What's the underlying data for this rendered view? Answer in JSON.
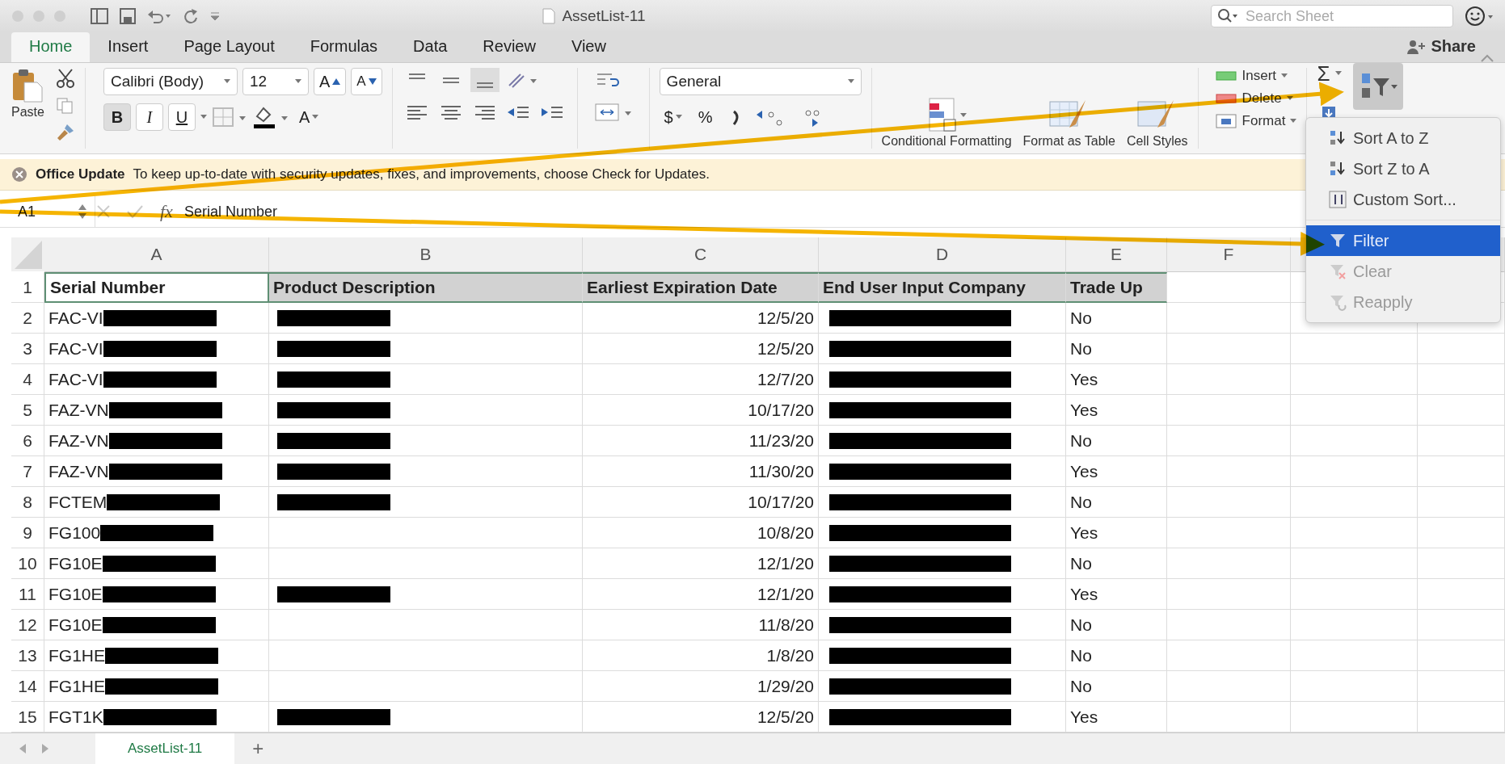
{
  "window": {
    "title": "AssetList-11",
    "search_placeholder": "Search Sheet"
  },
  "tabs": [
    {
      "label": "Home",
      "selected": true
    },
    {
      "label": "Insert",
      "selected": false
    },
    {
      "label": "Page Layout",
      "selected": false
    },
    {
      "label": "Formulas",
      "selected": false
    },
    {
      "label": "Data",
      "selected": false
    },
    {
      "label": "Review",
      "selected": false
    },
    {
      "label": "View",
      "selected": false
    }
  ],
  "share": "Share",
  "ribbon": {
    "paste": "Paste",
    "font_name": "Calibri (Body)",
    "font_size": "12",
    "bold": "B",
    "italic": "I",
    "underline": "U",
    "font_color": "A",
    "grow": "A",
    "shrink": "A",
    "number_format": "General",
    "currency": "$",
    "percent": "%",
    "conditional_formatting": "Conditional Formatting",
    "format_as_table": "Format as Table",
    "cell_styles": "Cell Styles",
    "insert": "Insert",
    "delete": "Delete",
    "format": "Format",
    "sum": "Σ"
  },
  "update_bar": {
    "title": "Office Update",
    "message": "To keep up-to-date with security updates, fixes, and improvements, choose Check for Updates."
  },
  "formula_bar": {
    "name_box": "A1",
    "fx": "fx",
    "value": "Serial Number"
  },
  "columns": [
    "A",
    "B",
    "C",
    "D",
    "E",
    "F"
  ],
  "header_row_num": "1",
  "header": [
    "Serial Number",
    "Product Description",
    "Earliest Expiration Date",
    "End User Input Company",
    "Trade Up"
  ],
  "rows": [
    {
      "num": "2",
      "serial": "FAC-VI",
      "product_redacted": true,
      "date": "12/5/20",
      "trade_up": "No"
    },
    {
      "num": "3",
      "serial": "FAC-VI",
      "product_redacted": true,
      "date": "12/5/20",
      "trade_up": "No"
    },
    {
      "num": "4",
      "serial": "FAC-VI",
      "product_redacted": true,
      "date": "12/7/20",
      "trade_up": "Yes"
    },
    {
      "num": "5",
      "serial": "FAZ-VN",
      "product_redacted": true,
      "date": "10/17/20",
      "trade_up": "Yes"
    },
    {
      "num": "6",
      "serial": "FAZ-VN",
      "product_redacted": true,
      "date": "11/23/20",
      "trade_up": "No"
    },
    {
      "num": "7",
      "serial": "FAZ-VN",
      "product_redacted": true,
      "date": "11/30/20",
      "trade_up": "Yes"
    },
    {
      "num": "8",
      "serial": "FCTEM",
      "product_redacted": true,
      "date": "10/17/20",
      "trade_up": "No"
    },
    {
      "num": "9",
      "serial": "FG100",
      "product_redacted": false,
      "date": "10/8/20",
      "trade_up": "Yes"
    },
    {
      "num": "10",
      "serial": "FG10E",
      "product_redacted": false,
      "date": "12/1/20",
      "trade_up": "No"
    },
    {
      "num": "11",
      "serial": "FG10E",
      "product_redacted": true,
      "date": "12/1/20",
      "trade_up": "Yes"
    },
    {
      "num": "12",
      "serial": "FG10E",
      "product_redacted": false,
      "date": "11/8/20",
      "trade_up": "No"
    },
    {
      "num": "13",
      "serial": "FG1HE",
      "product_redacted": false,
      "date": "1/8/20",
      "trade_up": "No"
    },
    {
      "num": "14",
      "serial": "FG1HE",
      "product_redacted": false,
      "date": "1/29/20",
      "trade_up": "No"
    },
    {
      "num": "15",
      "serial": "FGT1K",
      "product_redacted": true,
      "date": "12/5/20",
      "trade_up": "Yes"
    }
  ],
  "sort_menu": {
    "items": [
      {
        "label": "Sort A to Z",
        "kind": "sort-asc",
        "selected": false,
        "disabled": false
      },
      {
        "label": "Sort Z to A",
        "kind": "sort-desc",
        "selected": false,
        "disabled": false
      },
      {
        "label": "Custom Sort...",
        "kind": "custom",
        "selected": false,
        "disabled": false
      },
      {
        "label": "Filter",
        "kind": "filter",
        "selected": true,
        "disabled": false
      },
      {
        "label": "Clear",
        "kind": "clear",
        "selected": false,
        "disabled": true
      },
      {
        "label": "Reapply",
        "kind": "reapply",
        "selected": false,
        "disabled": true
      }
    ]
  },
  "sheet_tabs": [
    {
      "label": "AssetList-11",
      "selected": true
    }
  ],
  "add_sheet": "+"
}
